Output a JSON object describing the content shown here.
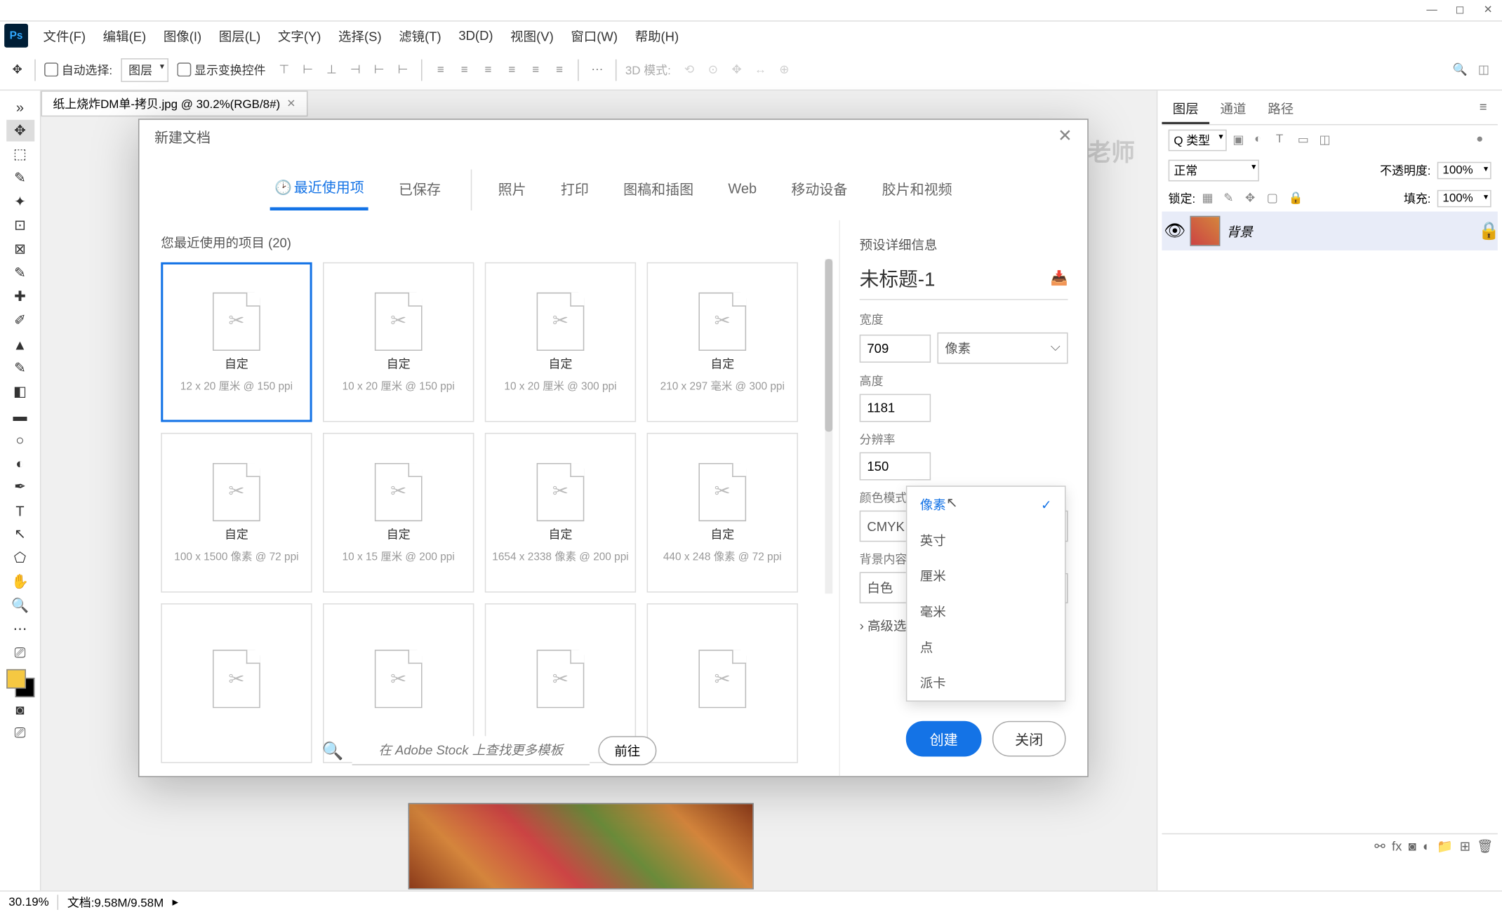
{
  "menubar": [
    "文件(F)",
    "编辑(E)",
    "图像(I)",
    "图层(L)",
    "文字(Y)",
    "选择(S)",
    "滤镜(T)",
    "3D(D)",
    "视图(V)",
    "窗口(W)",
    "帮助(H)"
  ],
  "optionbar": {
    "autoselect": "自动选择:",
    "layer": "图层",
    "transform": "显示变换控件",
    "mode3d": "3D 模式:"
  },
  "doc_tab": "纸上烧炸DM单-拷贝.jpg @ 30.2%(RGB/8#)",
  "watermark": "徐sir老师",
  "panel": {
    "tabs": [
      "图层",
      "通道",
      "路径"
    ],
    "filter": "Q 类型",
    "blend": "正常",
    "opacity_label": "不透明度:",
    "opacity": "100%",
    "lock_label": "锁定:",
    "fill_label": "填充:",
    "fill": "100%",
    "layer_name": "背景"
  },
  "status": {
    "zoom": "30.19%",
    "doc": "文档:9.58M/9.58M"
  },
  "dialog": {
    "title": "新建文档",
    "tabs": [
      "最近使用项",
      "已保存",
      "照片",
      "打印",
      "图稿和插图",
      "Web",
      "移动设备",
      "胶片和视频"
    ],
    "recent_title": "您最近使用的项目 (20)",
    "presets": [
      {
        "name": "自定",
        "dim": "12 x 20 厘米 @ 150 ppi",
        "selected": true
      },
      {
        "name": "自定",
        "dim": "10 x 20 厘米 @ 150 ppi"
      },
      {
        "name": "自定",
        "dim": "10 x 20 厘米 @ 300 ppi"
      },
      {
        "name": "自定",
        "dim": "210 x 297 毫米 @ 300 ppi"
      },
      {
        "name": "自定",
        "dim": "100 x 1500 像素 @ 72 ppi"
      },
      {
        "name": "自定",
        "dim": "10 x 15 厘米 @ 200 ppi"
      },
      {
        "name": "自定",
        "dim": "1654 x 2338 像素 @ 200 ppi"
      },
      {
        "name": "自定",
        "dim": "440 x 248 像素 @ 72 ppi"
      },
      {
        "name": "",
        "dim": ""
      },
      {
        "name": "",
        "dim": ""
      },
      {
        "name": "",
        "dim": ""
      },
      {
        "name": "",
        "dim": ""
      }
    ],
    "stock_placeholder": "在 Adobe Stock 上查找更多模板",
    "stock_go": "前往",
    "detail": {
      "section": "预设详细信息",
      "name": "未标题-1",
      "width_label": "宽度",
      "width": "709",
      "unit": "像素",
      "height_label": "高度",
      "height": "1181",
      "res_label": "分辨率",
      "res": "150",
      "color_label": "颜色模式",
      "color": "CMYK 颜色",
      "bg_label": "背景内容",
      "bg": "白色",
      "adv": "高级选项"
    },
    "units": [
      "像素",
      "英寸",
      "厘米",
      "毫米",
      "点",
      "派卡"
    ],
    "create": "创建",
    "close": "关闭"
  }
}
